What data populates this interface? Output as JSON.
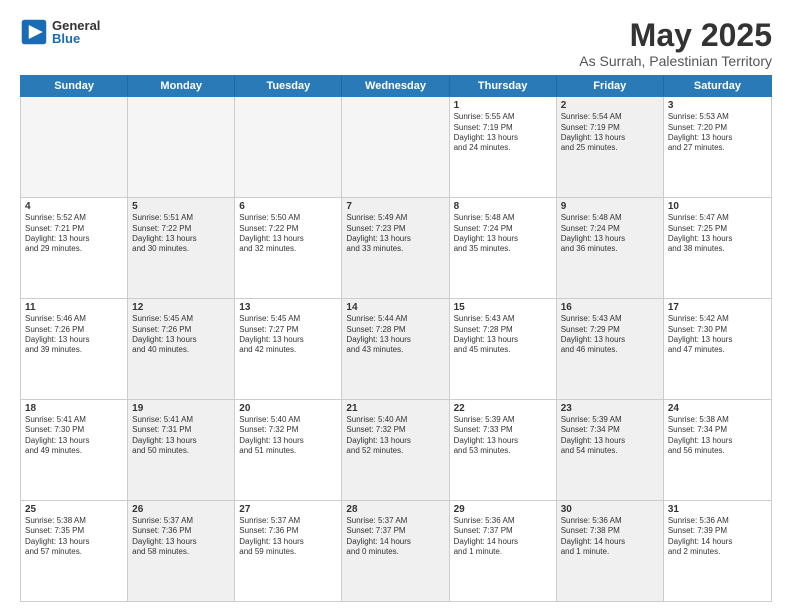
{
  "logo": {
    "general": "General",
    "blue": "Blue"
  },
  "title": "May 2025",
  "subtitle": "As Surrah, Palestinian Territory",
  "days": [
    "Sunday",
    "Monday",
    "Tuesday",
    "Wednesday",
    "Thursday",
    "Friday",
    "Saturday"
  ],
  "weeks": [
    [
      {
        "day": "",
        "empty": true
      },
      {
        "day": "",
        "empty": true
      },
      {
        "day": "",
        "empty": true
      },
      {
        "day": "",
        "empty": true
      },
      {
        "day": "1",
        "lines": [
          "Sunrise: 5:55 AM",
          "Sunset: 7:19 PM",
          "Daylight: 13 hours",
          "and 24 minutes."
        ]
      },
      {
        "day": "2",
        "shaded": true,
        "lines": [
          "Sunrise: 5:54 AM",
          "Sunset: 7:19 PM",
          "Daylight: 13 hours",
          "and 25 minutes."
        ]
      },
      {
        "day": "3",
        "lines": [
          "Sunrise: 5:53 AM",
          "Sunset: 7:20 PM",
          "Daylight: 13 hours",
          "and 27 minutes."
        ]
      }
    ],
    [
      {
        "day": "4",
        "lines": [
          "Sunrise: 5:52 AM",
          "Sunset: 7:21 PM",
          "Daylight: 13 hours",
          "and 29 minutes."
        ]
      },
      {
        "day": "5",
        "shaded": true,
        "lines": [
          "Sunrise: 5:51 AM",
          "Sunset: 7:22 PM",
          "Daylight: 13 hours",
          "and 30 minutes."
        ]
      },
      {
        "day": "6",
        "lines": [
          "Sunrise: 5:50 AM",
          "Sunset: 7:22 PM",
          "Daylight: 13 hours",
          "and 32 minutes."
        ]
      },
      {
        "day": "7",
        "shaded": true,
        "lines": [
          "Sunrise: 5:49 AM",
          "Sunset: 7:23 PM",
          "Daylight: 13 hours",
          "and 33 minutes."
        ]
      },
      {
        "day": "8",
        "lines": [
          "Sunrise: 5:48 AM",
          "Sunset: 7:24 PM",
          "Daylight: 13 hours",
          "and 35 minutes."
        ]
      },
      {
        "day": "9",
        "shaded": true,
        "lines": [
          "Sunrise: 5:48 AM",
          "Sunset: 7:24 PM",
          "Daylight: 13 hours",
          "and 36 minutes."
        ]
      },
      {
        "day": "10",
        "lines": [
          "Sunrise: 5:47 AM",
          "Sunset: 7:25 PM",
          "Daylight: 13 hours",
          "and 38 minutes."
        ]
      }
    ],
    [
      {
        "day": "11",
        "lines": [
          "Sunrise: 5:46 AM",
          "Sunset: 7:26 PM",
          "Daylight: 13 hours",
          "and 39 minutes."
        ]
      },
      {
        "day": "12",
        "shaded": true,
        "lines": [
          "Sunrise: 5:45 AM",
          "Sunset: 7:26 PM",
          "Daylight: 13 hours",
          "and 40 minutes."
        ]
      },
      {
        "day": "13",
        "lines": [
          "Sunrise: 5:45 AM",
          "Sunset: 7:27 PM",
          "Daylight: 13 hours",
          "and 42 minutes."
        ]
      },
      {
        "day": "14",
        "shaded": true,
        "lines": [
          "Sunrise: 5:44 AM",
          "Sunset: 7:28 PM",
          "Daylight: 13 hours",
          "and 43 minutes."
        ]
      },
      {
        "day": "15",
        "lines": [
          "Sunrise: 5:43 AM",
          "Sunset: 7:28 PM",
          "Daylight: 13 hours",
          "and 45 minutes."
        ]
      },
      {
        "day": "16",
        "shaded": true,
        "lines": [
          "Sunrise: 5:43 AM",
          "Sunset: 7:29 PM",
          "Daylight: 13 hours",
          "and 46 minutes."
        ]
      },
      {
        "day": "17",
        "lines": [
          "Sunrise: 5:42 AM",
          "Sunset: 7:30 PM",
          "Daylight: 13 hours",
          "and 47 minutes."
        ]
      }
    ],
    [
      {
        "day": "18",
        "lines": [
          "Sunrise: 5:41 AM",
          "Sunset: 7:30 PM",
          "Daylight: 13 hours",
          "and 49 minutes."
        ]
      },
      {
        "day": "19",
        "shaded": true,
        "lines": [
          "Sunrise: 5:41 AM",
          "Sunset: 7:31 PM",
          "Daylight: 13 hours",
          "and 50 minutes."
        ]
      },
      {
        "day": "20",
        "lines": [
          "Sunrise: 5:40 AM",
          "Sunset: 7:32 PM",
          "Daylight: 13 hours",
          "and 51 minutes."
        ]
      },
      {
        "day": "21",
        "shaded": true,
        "lines": [
          "Sunrise: 5:40 AM",
          "Sunset: 7:32 PM",
          "Daylight: 13 hours",
          "and 52 minutes."
        ]
      },
      {
        "day": "22",
        "lines": [
          "Sunrise: 5:39 AM",
          "Sunset: 7:33 PM",
          "Daylight: 13 hours",
          "and 53 minutes."
        ]
      },
      {
        "day": "23",
        "shaded": true,
        "lines": [
          "Sunrise: 5:39 AM",
          "Sunset: 7:34 PM",
          "Daylight: 13 hours",
          "and 54 minutes."
        ]
      },
      {
        "day": "24",
        "lines": [
          "Sunrise: 5:38 AM",
          "Sunset: 7:34 PM",
          "Daylight: 13 hours",
          "and 56 minutes."
        ]
      }
    ],
    [
      {
        "day": "25",
        "lines": [
          "Sunrise: 5:38 AM",
          "Sunset: 7:35 PM",
          "Daylight: 13 hours",
          "and 57 minutes."
        ]
      },
      {
        "day": "26",
        "shaded": true,
        "lines": [
          "Sunrise: 5:37 AM",
          "Sunset: 7:36 PM",
          "Daylight: 13 hours",
          "and 58 minutes."
        ]
      },
      {
        "day": "27",
        "lines": [
          "Sunrise: 5:37 AM",
          "Sunset: 7:36 PM",
          "Daylight: 13 hours",
          "and 59 minutes."
        ]
      },
      {
        "day": "28",
        "shaded": true,
        "lines": [
          "Sunrise: 5:37 AM",
          "Sunset: 7:37 PM",
          "Daylight: 14 hours",
          "and 0 minutes."
        ]
      },
      {
        "day": "29",
        "lines": [
          "Sunrise: 5:36 AM",
          "Sunset: 7:37 PM",
          "Daylight: 14 hours",
          "and 1 minute."
        ]
      },
      {
        "day": "30",
        "shaded": true,
        "lines": [
          "Sunrise: 5:36 AM",
          "Sunset: 7:38 PM",
          "Daylight: 14 hours",
          "and 1 minute."
        ]
      },
      {
        "day": "31",
        "lines": [
          "Sunrise: 5:36 AM",
          "Sunset: 7:39 PM",
          "Daylight: 14 hours",
          "and 2 minutes."
        ]
      }
    ]
  ]
}
